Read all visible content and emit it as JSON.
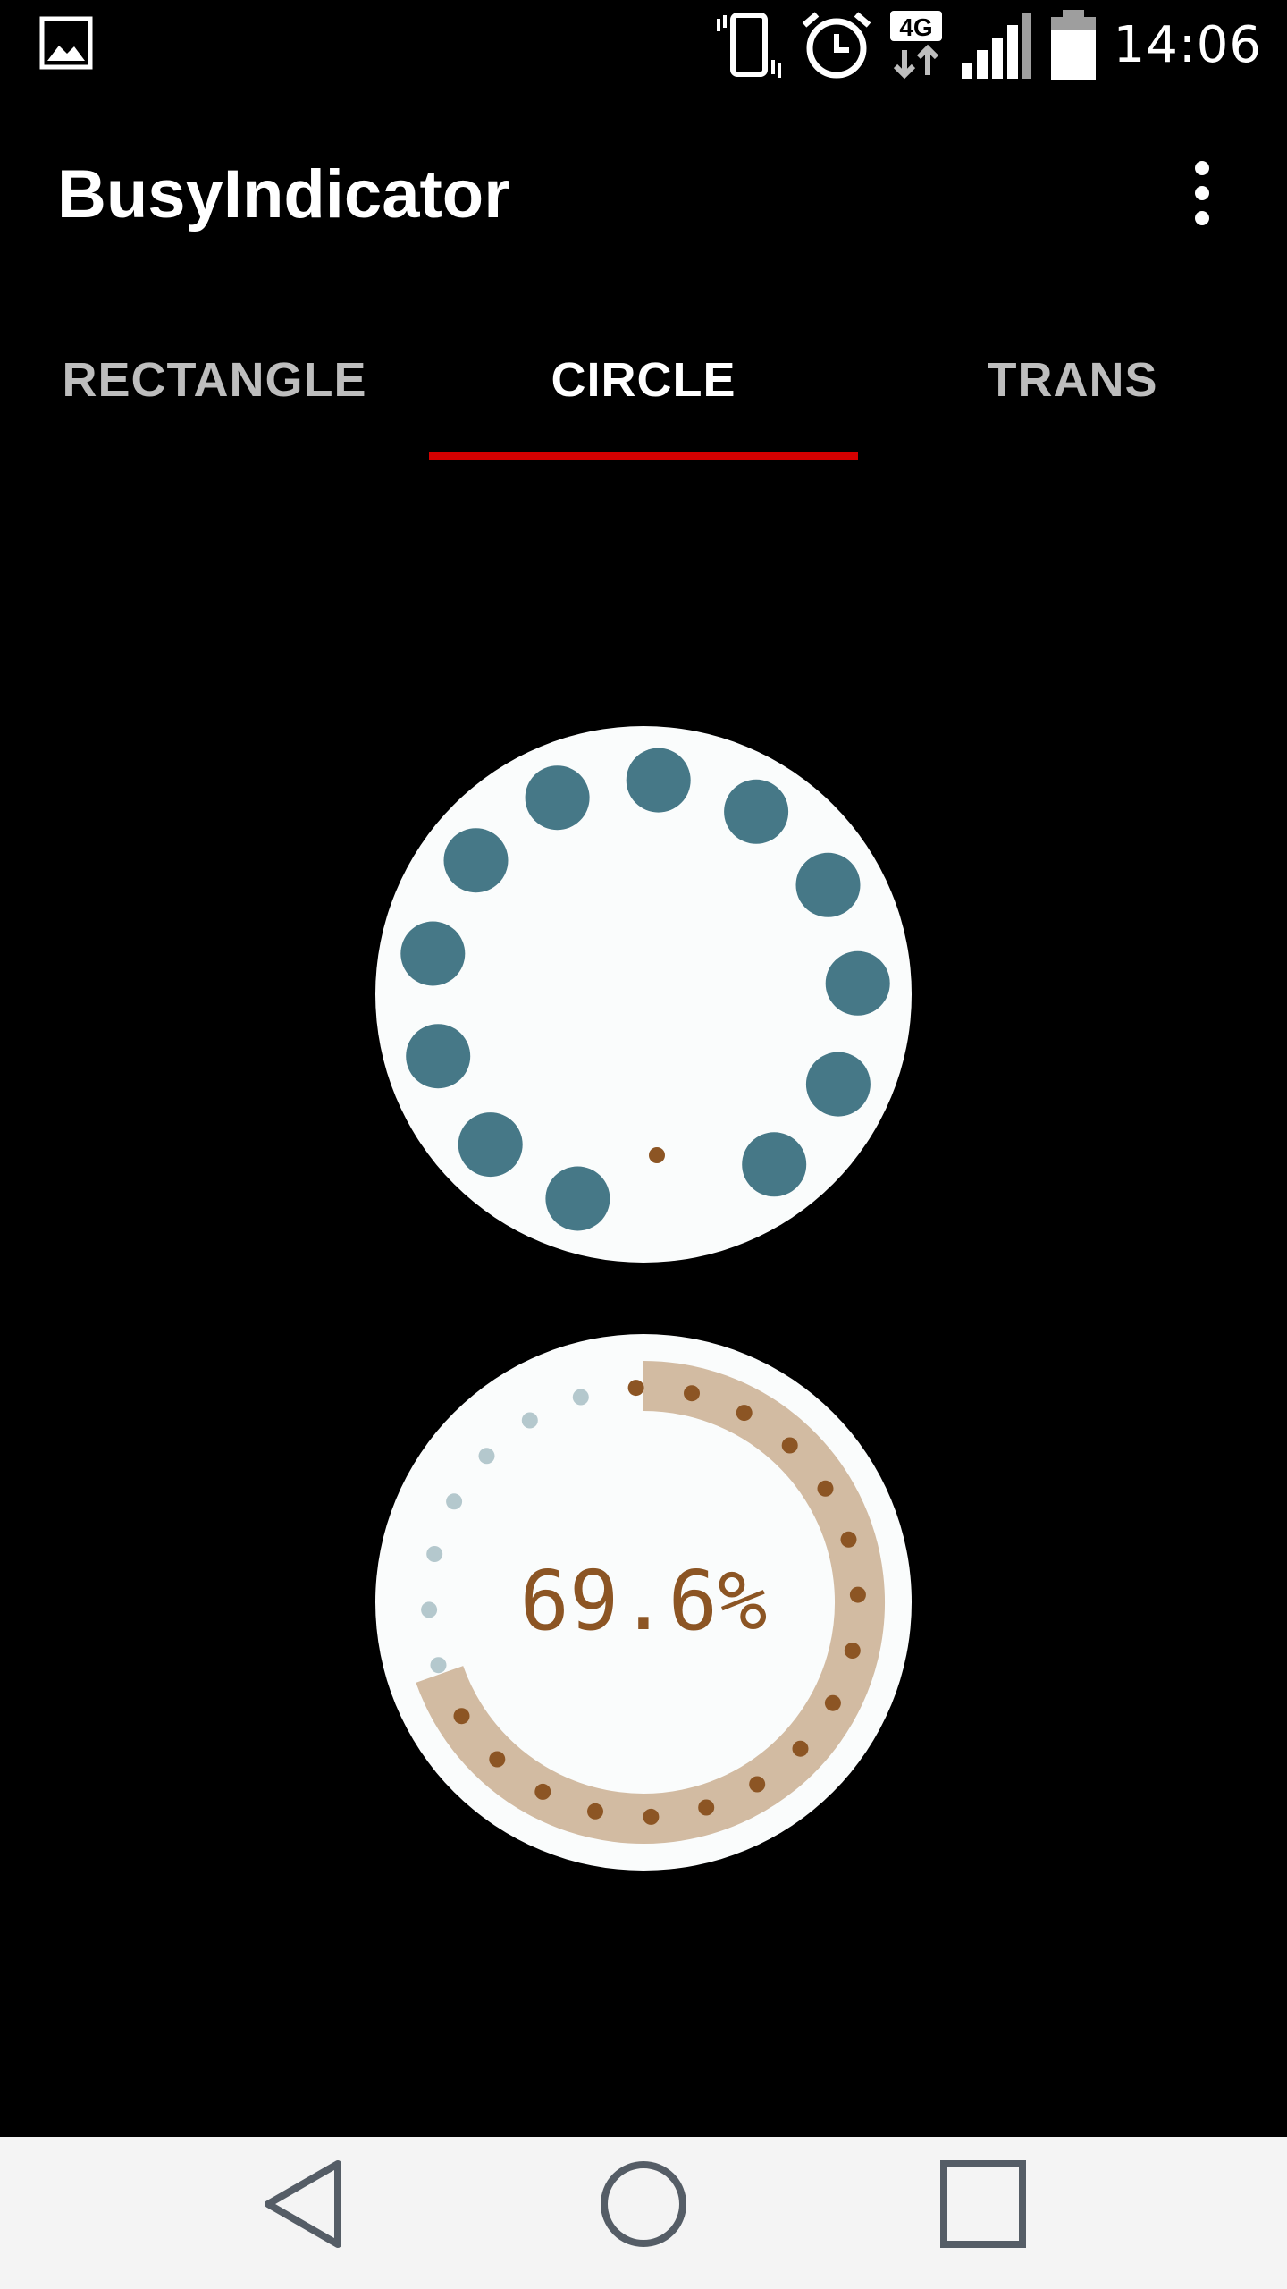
{
  "status_bar": {
    "time": "14:06",
    "network": "4G",
    "icons": [
      "gallery-icon",
      "vibrate-icon",
      "alarm-icon",
      "network-4g-icon",
      "signal-icon",
      "battery-icon"
    ]
  },
  "app_bar": {
    "title": "BusyIndicator",
    "overflow_icon": "more-vert-icon"
  },
  "tabs": [
    {
      "label": "RECTANGLE",
      "active": false
    },
    {
      "label": "CIRCLE",
      "active": true
    },
    {
      "label": "TRANS",
      "active": false
    }
  ],
  "busy_indicator": {
    "style": "circle",
    "dot_color": "#467887",
    "background_color": "#fafcfc",
    "accent_dot_color": "#8c5524"
  },
  "progress_indicator": {
    "progress_text": "69.6%",
    "progress": 0.696,
    "track_color": "#d2bba2",
    "dot_color": "#8c5524",
    "inactive_dot_color": "#b4c8cd"
  },
  "nav_bar": {
    "buttons": [
      "back-icon",
      "home-icon",
      "recents-icon"
    ]
  },
  "colors": {
    "background": "#000000",
    "tab_indicator": "#d50000",
    "nav_bar_bg": "#f4f4f4",
    "nav_icon": "#555d66"
  }
}
